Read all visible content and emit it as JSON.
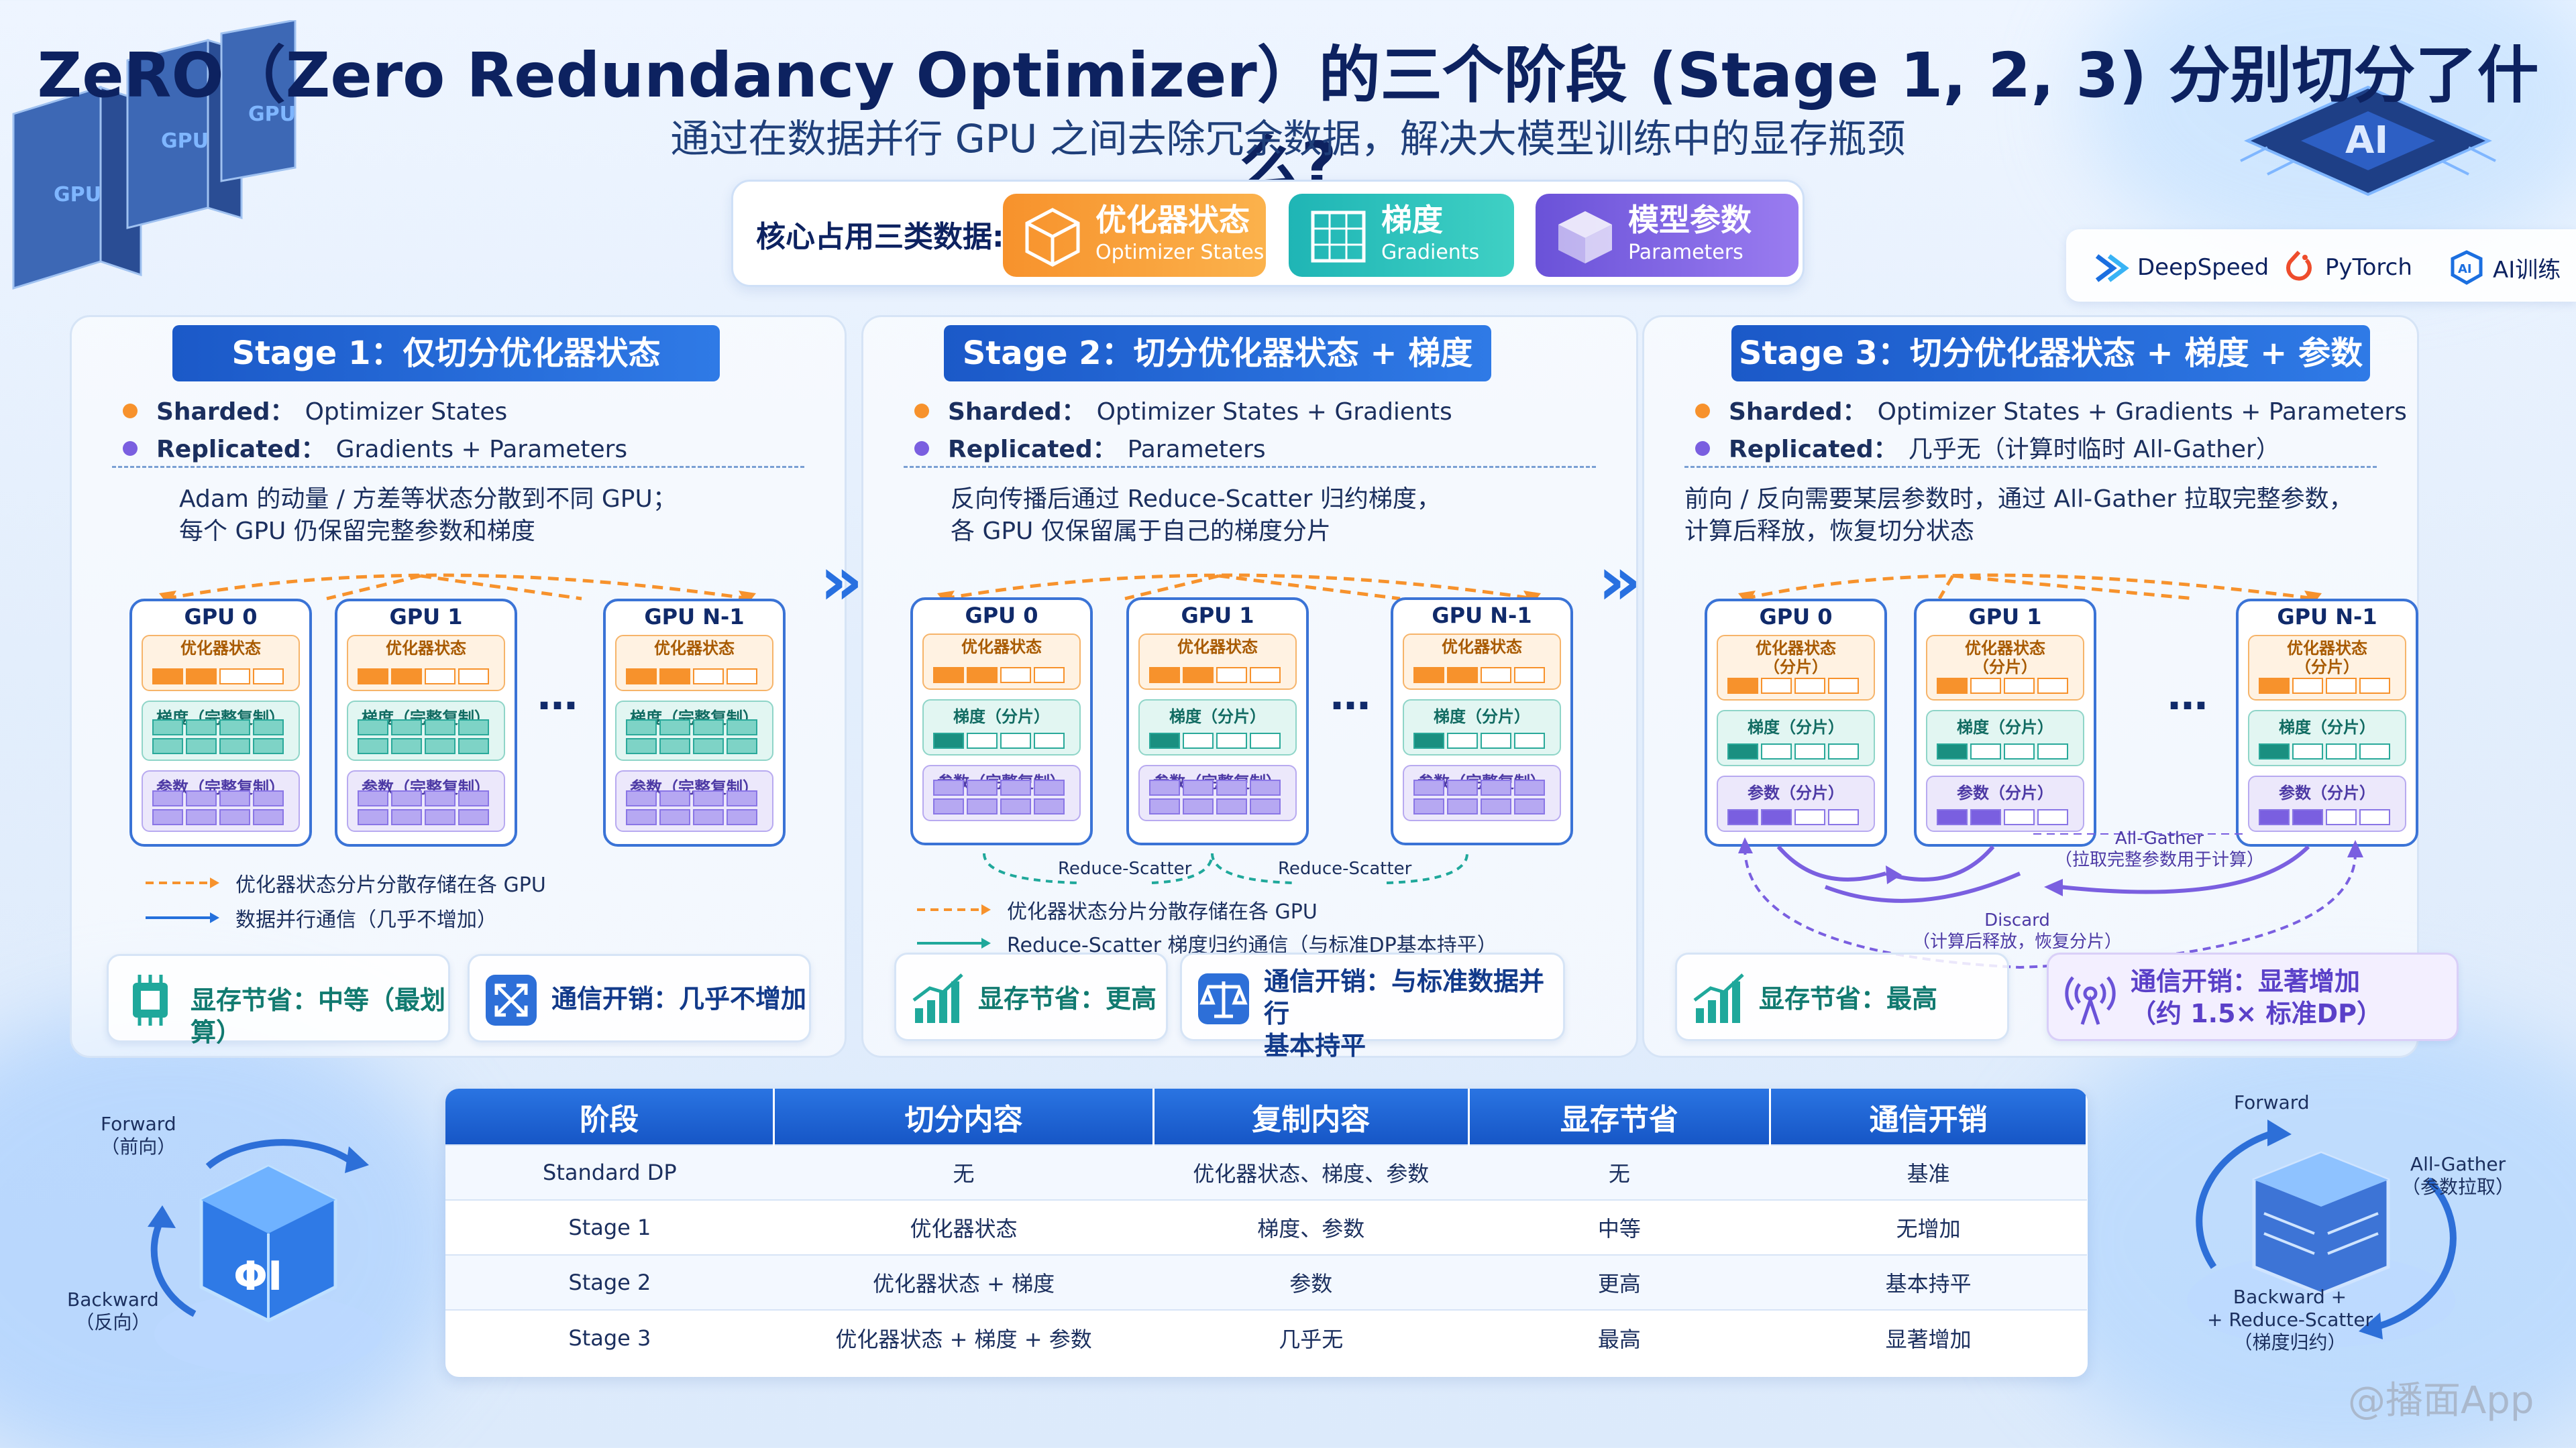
{
  "header": {
    "title": "ZeRO（Zero Redundancy Optimizer）的三个阶段 (Stage 1, 2, 3) 分别切分了什么?",
    "subtitle": "通过在数据并行 GPU 之间去除冗余数据，解决大模型训练中的显存瓶颈"
  },
  "core": {
    "label": "核心占用三类数据:",
    "items": [
      {
        "cn": "优化器状态",
        "en": "Optimizer States"
      },
      {
        "cn": "梯度",
        "en": "Gradients"
      },
      {
        "cn": "模型参数",
        "en": "Parameters"
      }
    ]
  },
  "brands": [
    "DeepSpeed",
    "PyTorch",
    "AI训练"
  ],
  "decor": {
    "gpu_rack": "GPU",
    "ai_chip": "AI",
    "left_cube": "ΦI"
  },
  "colors": {
    "orange": "#f7922c",
    "teal": "#1fb5b5",
    "purple": "#7a5fe0",
    "blue": "#1b59c8"
  },
  "common": {
    "sharded": "Sharded：",
    "replicated": "Replicated：",
    "gpus": [
      "GPU 0",
      "GPU 1",
      "GPU N-1"
    ],
    "ellipsis": "…",
    "opt": "优化器状态",
    "opt_shard": "优化器状态\n（分片）",
    "grad_full": "梯度（完整复制）",
    "grad_shard": "梯度（分片）",
    "par_full": "参数（完整复制）",
    "par_shard": "参数（分片）"
  },
  "stages": [
    {
      "title": "Stage 1：仅切分优化器状态",
      "sharded": "Optimizer States",
      "replicated": "Gradients + Parameters",
      "desc": "Adam 的动量 / 方差等状态分散到不同 GPU；\n每个 GPU 仍保留完整参数和梯度",
      "legend": [
        "优化器状态分片分散存储在各 GPU",
        "数据并行通信（几乎不增加）"
      ],
      "foot1": "显存节省：中等（最划算）",
      "foot2": "通信开销：几乎不增加"
    },
    {
      "title": "Stage 2：切分优化器状态 + 梯度",
      "sharded": "Optimizer States + Gradients",
      "replicated": "Parameters",
      "desc": "反向传播后通过 Reduce-Scatter 归约梯度，\n各 GPU 仅保留属于自己的梯度分片",
      "rs": "Reduce-Scatter",
      "legend": [
        "优化器状态分片分散存储在各 GPU",
        "Reduce-Scatter 梯度归约通信（与标准DP基本持平）"
      ],
      "foot1": "显存节省：更高",
      "foot2": "通信开销：与标准数据并行\n基本持平"
    },
    {
      "title": "Stage 3：切分优化器状态 + 梯度 + 参数",
      "sharded": "Optimizer States + Gradients + Parameters",
      "replicated": "几乎无（计算时临时 All-Gather）",
      "desc": "前向 / 反向需要某层参数时，通过 All-Gather 拉取完整参数，\n计算后释放，恢复切分状态",
      "allgather": "All-Gather\n（拉取完整参数用于计算）",
      "discard": "Discard\n（计算后释放，恢复分片）",
      "foot1": "显存节省：最高",
      "foot2": "通信开销：显著增加\n（约 1.5× 标准DP）"
    }
  ],
  "table": {
    "headers": [
      "阶段",
      "切分内容",
      "复制内容",
      "显存节省",
      "通信开销"
    ],
    "rows": [
      [
        "Standard DP",
        "无",
        "优化器状态、梯度、参数",
        "无",
        "基准"
      ],
      [
        "Stage 1",
        "优化器状态",
        "梯度、参数",
        "中等",
        "无增加"
      ],
      [
        "Stage 2",
        "优化器状态 + 梯度",
        "参数",
        "更高",
        "基本持平"
      ],
      [
        "Stage 3",
        "优化器状态 + 梯度 + 参数",
        "几乎无",
        "最高",
        "显著增加"
      ]
    ]
  },
  "left_deco": {
    "forward": "Forward\n（前向）",
    "backward": "Backward\n（反向）"
  },
  "right_deco": {
    "forward": "Forward",
    "allgather": "All-Gather\n（参数拉取）",
    "backward": "Backward  +\n+ Reduce-Scatter\n（梯度归约）"
  },
  "watermark": "@播面App"
}
